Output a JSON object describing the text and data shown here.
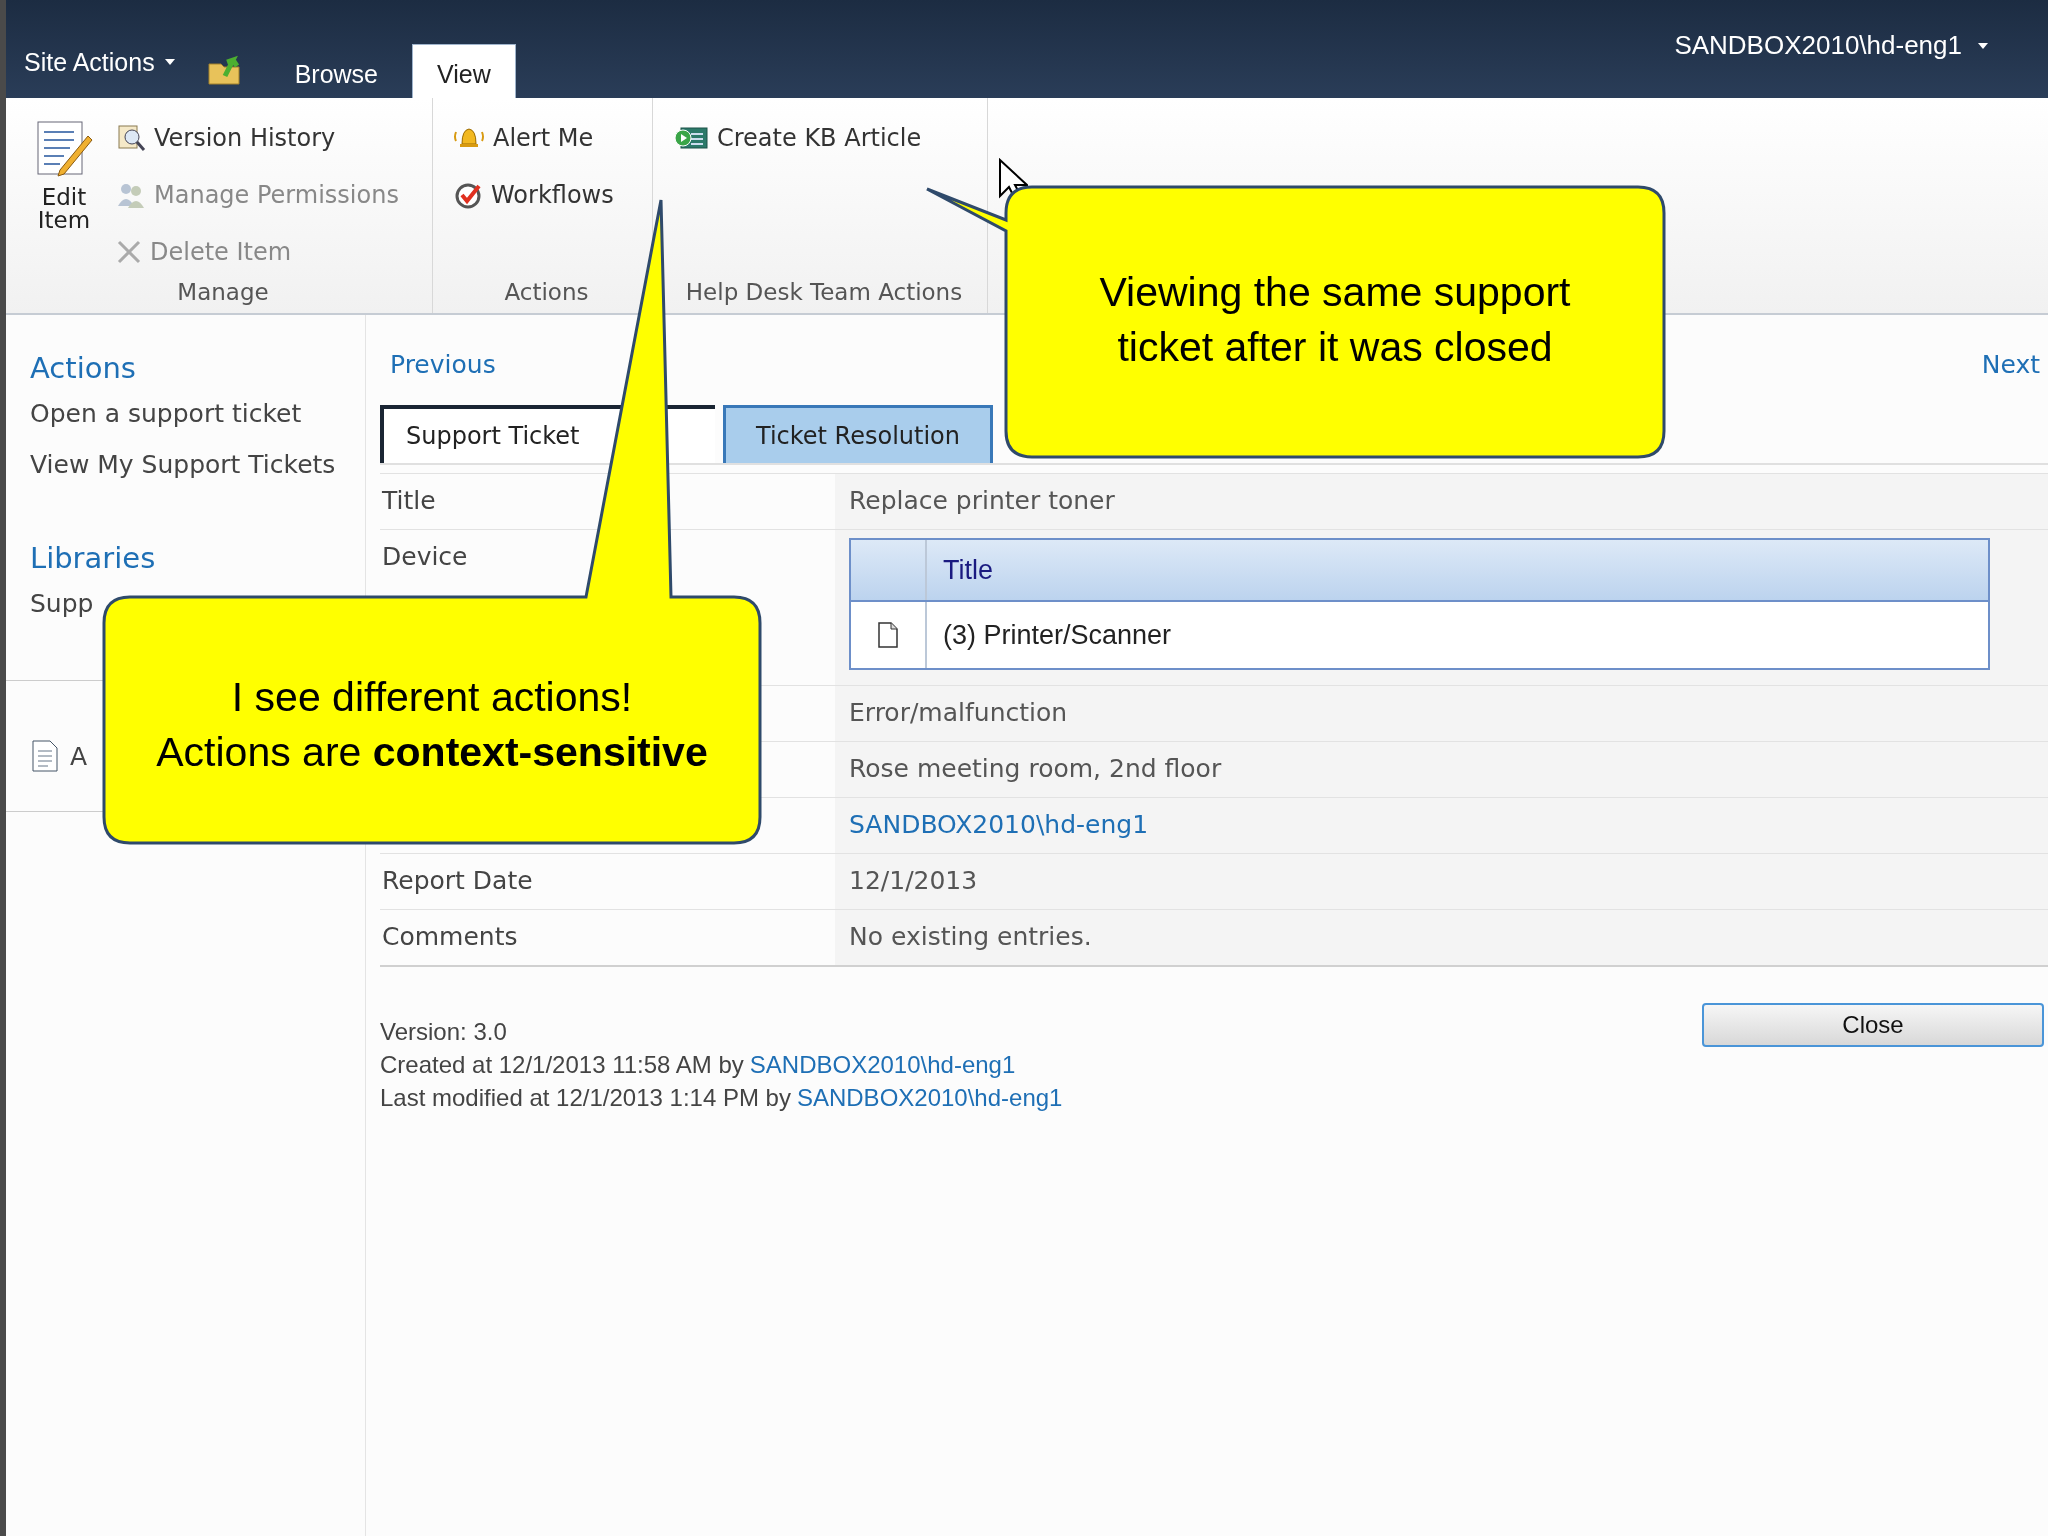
{
  "top_bar": {
    "site_actions": "Site Actions",
    "tabs": [
      {
        "label": "Browse",
        "selected": false
      },
      {
        "label": "View",
        "selected": true
      }
    ],
    "user": "SANDBOX2010\\hd-eng1"
  },
  "ribbon": {
    "groups": [
      {
        "label": "Manage",
        "items": [
          {
            "kind": "large",
            "label": "Edit Item",
            "disabled": false
          },
          {
            "kind": "small",
            "label": "Version History",
            "disabled": false
          },
          {
            "kind": "small",
            "label": "Manage Permissions",
            "disabled": true
          },
          {
            "kind": "small",
            "label": "Delete Item",
            "disabled": true
          }
        ]
      },
      {
        "label": "Actions",
        "items": [
          {
            "kind": "small",
            "label": "Alert Me",
            "disabled": false
          },
          {
            "kind": "small",
            "label": "Workflows",
            "disabled": false
          }
        ]
      },
      {
        "label": "Help Desk Team Actions",
        "items": [
          {
            "kind": "small",
            "label": "Create KB Article",
            "disabled": false
          }
        ]
      }
    ]
  },
  "sidebar": {
    "sections": [
      {
        "heading": "Actions",
        "items": [
          "Open a support ticket",
          "View My Support Tickets"
        ]
      },
      {
        "heading": "Libraries",
        "items": [
          "Supp"
        ]
      }
    ],
    "extra_item": "A"
  },
  "pager": {
    "previous": "Previous",
    "next": "Next"
  },
  "form_tabs": [
    {
      "label": "Support Ticket",
      "selected": true
    },
    {
      "label": "Ticket Resolution",
      "selected": false
    }
  ],
  "fields": [
    {
      "kind": "text",
      "label": "Title",
      "value": "Replace printer toner"
    },
    {
      "kind": "lookup",
      "label": "Device",
      "column": "Title",
      "rows": [
        "(3) Printer/Scanner"
      ]
    },
    {
      "kind": "text",
      "value": "Error/malfunction"
    },
    {
      "kind": "text",
      "value": "Rose meeting room, 2nd floor"
    },
    {
      "kind": "link",
      "value": "SANDBOX2010\\hd-eng1"
    },
    {
      "kind": "text",
      "label": "Report Date",
      "value": "12/1/2013"
    },
    {
      "kind": "text",
      "label": "Comments",
      "value": "No existing entries."
    }
  ],
  "footer": {
    "version": "Version: 3.0",
    "created": "Created at 12/1/2013 11:58 AM by",
    "created_by": "SANDBOX2010\\hd-eng1",
    "modified": "Last modified at 12/1/2013 1:14 PM by",
    "modified_by": "SANDBOX2010\\hd-eng1",
    "close_button": "Close"
  },
  "callouts": [
    {
      "lines": [
        "Viewing the same support",
        "ticket after it was closed"
      ]
    },
    {
      "lines": [
        "I see different actions!",
        "Actions are **context-sensitive**"
      ]
    }
  ]
}
